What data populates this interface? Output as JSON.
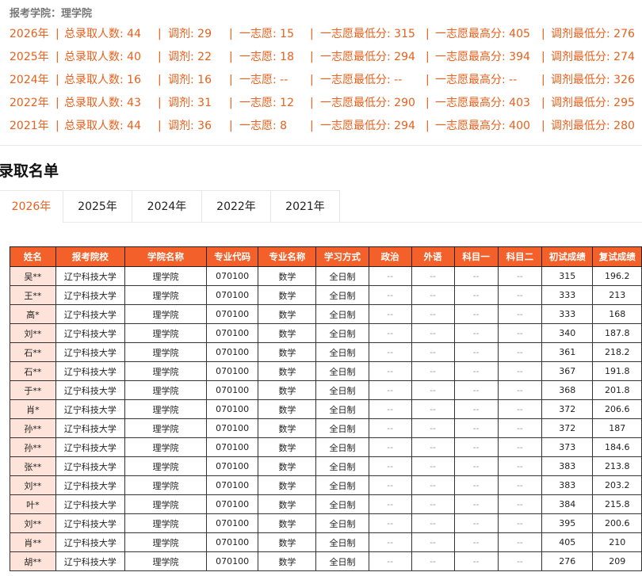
{
  "header": {
    "college": "报考学院：理学院"
  },
  "stats": [
    {
      "year": "2026年",
      "total": "总录取人数: 44",
      "adjust": "调剂: 29",
      "first": "一志愿: 15",
      "first_min": "一志愿最低分: 315",
      "first_max": "一志愿最高分: 405",
      "adjust_min": "调剂最低分: 276"
    },
    {
      "year": "2025年",
      "total": "总录取人数: 40",
      "adjust": "调剂: 22",
      "first": "一志愿: 18",
      "first_min": "一志愿最低分: 294",
      "first_max": "一志愿最高分: 394",
      "adjust_min": "调剂最低分: 274"
    },
    {
      "year": "2024年",
      "total": "总录取人数: 16",
      "adjust": "调剂: 16",
      "first": "一志愿: --",
      "first_min": "一志愿最低分: --",
      "first_max": "一志愿最高分: --",
      "adjust_min": "调剂最低分: 326"
    },
    {
      "year": "2022年",
      "total": "总录取人数: 43",
      "adjust": "调剂: 31",
      "first": "一志愿: 12",
      "first_min": "一志愿最低分: 290",
      "first_max": "一志愿最高分: 403",
      "adjust_min": "调剂最低分: 295"
    },
    {
      "year": "2021年",
      "total": "总录取人数: 44",
      "adjust": "调剂: 36",
      "first": "一志愿: 8",
      "first_min": "一志愿最低分: 294",
      "first_max": "一志愿最高分: 400",
      "adjust_min": "调剂最低分: 280"
    }
  ],
  "separator": "|",
  "section_title": "录取名单",
  "tabs": [
    "2026年",
    "2025年",
    "2024年",
    "2022年",
    "2021年"
  ],
  "active_tab": "2026年",
  "table": {
    "headers": [
      "姓名",
      "报考院校",
      "学院名称",
      "专业代码",
      "专业名称",
      "学习方式",
      "政治",
      "外语",
      "科目一",
      "科目二",
      "初试成绩",
      "复试成绩"
    ],
    "rows": [
      [
        "吴**",
        "辽宁科技大学",
        "理学院",
        "070100",
        "数学",
        "全日制",
        "--",
        "--",
        "--",
        "--",
        "315",
        "196.2"
      ],
      [
        "王**",
        "辽宁科技大学",
        "理学院",
        "070100",
        "数学",
        "全日制",
        "--",
        "--",
        "--",
        "--",
        "333",
        "213"
      ],
      [
        "高*",
        "辽宁科技大学",
        "理学院",
        "070100",
        "数学",
        "全日制",
        "--",
        "--",
        "--",
        "--",
        "333",
        "168"
      ],
      [
        "刘**",
        "辽宁科技大学",
        "理学院",
        "070100",
        "数学",
        "全日制",
        "--",
        "--",
        "--",
        "--",
        "340",
        "187.8"
      ],
      [
        "石**",
        "辽宁科技大学",
        "理学院",
        "070100",
        "数学",
        "全日制",
        "--",
        "--",
        "--",
        "--",
        "361",
        "218.2"
      ],
      [
        "石**",
        "辽宁科技大学",
        "理学院",
        "070100",
        "数学",
        "全日制",
        "--",
        "--",
        "--",
        "--",
        "367",
        "191.8"
      ],
      [
        "于**",
        "辽宁科技大学",
        "理学院",
        "070100",
        "数学",
        "全日制",
        "--",
        "--",
        "--",
        "--",
        "368",
        "201.8"
      ],
      [
        "肖*",
        "辽宁科技大学",
        "理学院",
        "070100",
        "数学",
        "全日制",
        "--",
        "--",
        "--",
        "--",
        "372",
        "206.6"
      ],
      [
        "孙**",
        "辽宁科技大学",
        "理学院",
        "070100",
        "数学",
        "全日制",
        "--",
        "--",
        "--",
        "--",
        "372",
        "187"
      ],
      [
        "孙**",
        "辽宁科技大学",
        "理学院",
        "070100",
        "数学",
        "全日制",
        "--",
        "--",
        "--",
        "--",
        "373",
        "184.6"
      ],
      [
        "张**",
        "辽宁科技大学",
        "理学院",
        "070100",
        "数学",
        "全日制",
        "--",
        "--",
        "--",
        "--",
        "383",
        "213.8"
      ],
      [
        "刘**",
        "辽宁科技大学",
        "理学院",
        "070100",
        "数学",
        "全日制",
        "--",
        "--",
        "--",
        "--",
        "383",
        "203.2"
      ],
      [
        "叶*",
        "辽宁科技大学",
        "理学院",
        "070100",
        "数学",
        "全日制",
        "--",
        "--",
        "--",
        "--",
        "384",
        "215.8"
      ],
      [
        "刘**",
        "辽宁科技大学",
        "理学院",
        "070100",
        "数学",
        "全日制",
        "--",
        "--",
        "--",
        "--",
        "395",
        "200.6"
      ],
      [
        "肖**",
        "辽宁科技大学",
        "理学院",
        "070100",
        "数学",
        "全日制",
        "--",
        "--",
        "--",
        "--",
        "405",
        "210"
      ],
      [
        "胡**",
        "辽宁科技大学",
        "理学院",
        "070100",
        "数学",
        "全日制",
        "--",
        "--",
        "--",
        "--",
        "276",
        "209"
      ]
    ]
  }
}
